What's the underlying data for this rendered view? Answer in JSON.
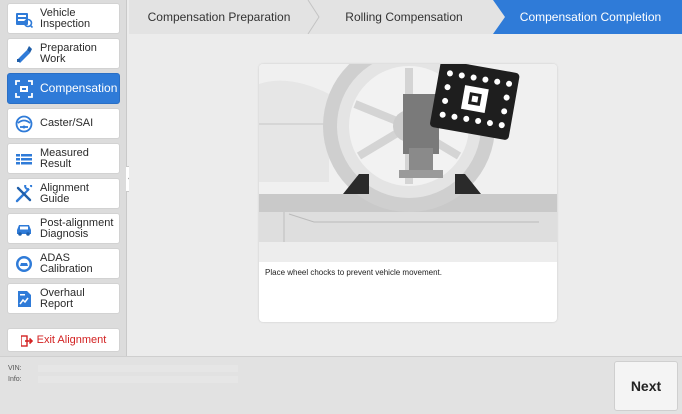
{
  "sidebar": {
    "items": [
      {
        "label": "Vehicle\nInspection",
        "icon": "vehicle-inspection-icon",
        "active": false
      },
      {
        "label": "Preparation\nWork",
        "icon": "preparation-icon",
        "active": false
      },
      {
        "label": "Compensation",
        "icon": "compensation-icon",
        "active": true
      },
      {
        "label": "Caster/SAI",
        "icon": "caster-icon",
        "active": false
      },
      {
        "label": "Measured\nResult",
        "icon": "measured-result-icon",
        "active": false
      },
      {
        "label": "Alignment\nGuide",
        "icon": "alignment-guide-icon",
        "active": false
      },
      {
        "label": "Post-alignment\nDiagnosis",
        "icon": "post-alignment-icon",
        "active": false
      },
      {
        "label": "ADAS\nCalibration",
        "icon": "adas-icon",
        "active": false
      },
      {
        "label": "Overhaul Report",
        "icon": "overhaul-report-icon",
        "active": false
      }
    ],
    "exit_label": "Exit Alignment"
  },
  "stepper": {
    "steps": [
      "Compensation Preparation",
      "Rolling Compensation",
      "Compensation Completion"
    ],
    "active_index": 2
  },
  "content": {
    "instruction": "Place wheel chocks to prevent vehicle movement."
  },
  "footer": {
    "vin_label": "VIN:",
    "info_label": "Info:",
    "next_label": "Next"
  },
  "colors": {
    "accent": "#2f7bd8",
    "exit": "#d32222"
  }
}
